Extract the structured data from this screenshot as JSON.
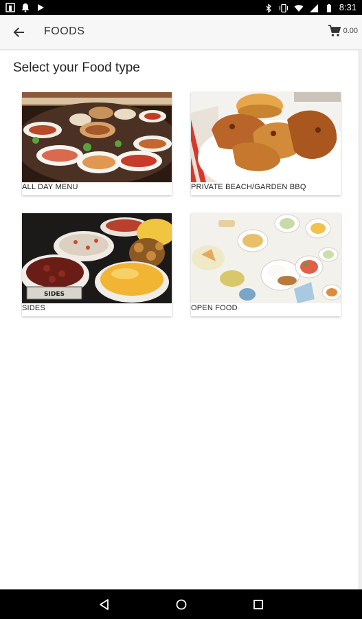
{
  "status_bar": {
    "time": "8:31",
    "left_icons": [
      "app-notification-icon",
      "notification-bell-icon",
      "media-play-icon"
    ],
    "right_icons": [
      "bluetooth-icon",
      "vibrate-icon",
      "wifi-icon",
      "signal-icon",
      "battery-icon"
    ]
  },
  "app_bar": {
    "title": "FOODS",
    "cart_total": "0.00"
  },
  "main": {
    "heading": "Select your Food type",
    "categories": [
      {
        "label": "ALL DAY MENU"
      },
      {
        "label": "PRIVATE BEACH/GARDEN BBQ"
      },
      {
        "label": "SIDES",
        "image_caption": "SIDES"
      },
      {
        "label": "OPEN FOOD"
      }
    ]
  },
  "nav_bar": {
    "buttons": [
      "back-triangle-icon",
      "home-circle-icon",
      "recents-square-icon"
    ]
  },
  "colors": {
    "status_bar": "#000000",
    "app_bar": "#f7f7f7",
    "nav_bar": "#000000",
    "text": "#222222"
  }
}
